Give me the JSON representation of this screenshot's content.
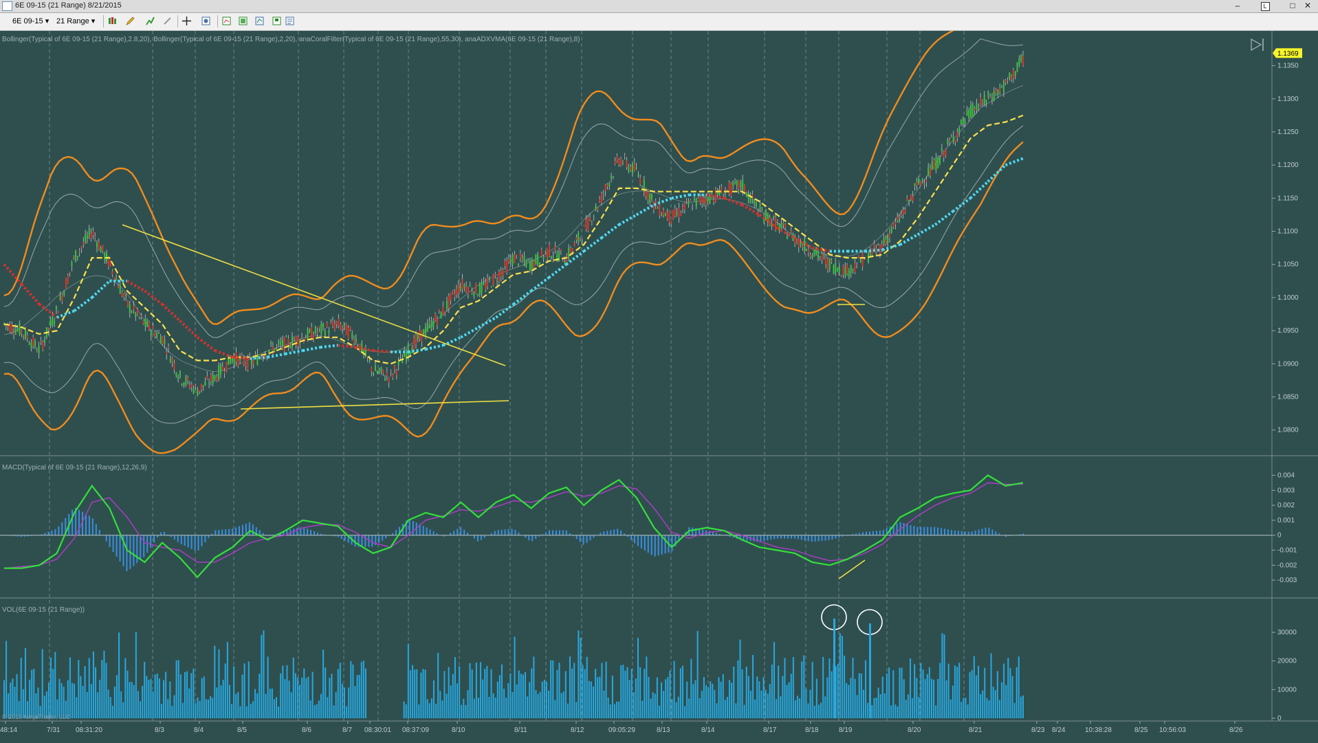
{
  "window": {
    "title": "6E 09-15 (21 Range)  8/21/2015",
    "minimize": "‒",
    "restore": "□",
    "close": "✕",
    "overlay_label": "L"
  },
  "toolbar": {
    "instrument": "6E 09-15",
    "period": "21 Range",
    "icons": [
      "bar-type-icon",
      "draw-pencil-icon",
      "marker-icon",
      "zoom-icon",
      "crosshair-icon",
      "properties-icon",
      "strategy-icon",
      "data-box-icon",
      "chart-trader-icon",
      "save-icon",
      "template-icon"
    ]
  },
  "colors": {
    "background": "#2f4f4f",
    "bollinger_outer": "#f28c1c",
    "bollinger_inner": "#9aa8a8",
    "coral_up": "#ffe14a",
    "coral_down": "#ffe14a",
    "adxvma_up": "#4fd9f0",
    "adxvma_down": "#d9302a",
    "trendline": "#f0e040",
    "macd": "#34e03a",
    "macd_avg": "#b03cc8",
    "macd_hist": "#3a8ee0",
    "volume": "#27a8e0",
    "last_price_marker": "#f7f52a"
  },
  "chart_data": [
    {
      "type": "line",
      "panel": "price",
      "title": "Bollinger(Typical of 6E 09-15 (21 Range),2.8,20), Bollinger(Typical of 6E 09-15 (21 Range),2,20), anaCoralFilter(Typical of 6E 09-15 (21 Range),55,30), anaADXVMA(6E 09-15 (21 Range),8)",
      "ylim": [
        1.078,
        1.139
      ],
      "y_ticks": [
        "1.1350",
        "1.1300",
        "1.1250",
        "1.1200",
        "1.1150",
        "1.1100",
        "1.1050",
        "1.1000",
        "1.0950",
        "1.0900",
        "1.0850",
        "1.0800"
      ],
      "last_price": "1.1369",
      "x_labels": [
        "48:14",
        "7/31",
        "08:31:20",
        "8/3",
        "8/4",
        "8/5",
        "8/6",
        "8/7",
        "08:30:01",
        "08:37:09",
        "8/10",
        "8/11",
        "8/12",
        "09:05:29",
        "8/13",
        "8/14",
        "8/17",
        "8/18",
        "8/19",
        "8/20",
        "8/21",
        "8/23",
        "8/24",
        "10:38:28",
        "8/25",
        "10:56:03",
        "8/26"
      ],
      "copyright": "© 2015 NinjaTrader, LLC",
      "series": [
        {
          "name": "Typical (price)",
          "values": [
            1.096,
            1.095,
            1.092,
            1.098,
            1.106,
            1.11,
            1.105,
            1.099,
            1.096,
            1.094,
            1.088,
            1.086,
            1.088,
            1.091,
            1.09,
            1.092,
            1.093,
            1.094,
            1.095,
            1.096,
            1.094,
            1.089,
            1.088,
            1.092,
            1.095,
            1.098,
            1.102,
            1.101,
            1.103,
            1.106,
            1.105,
            1.107,
            1.106,
            1.11,
            1.115,
            1.121,
            1.119,
            1.114,
            1.112,
            1.114,
            1.115,
            1.116,
            1.117,
            1.113,
            1.111,
            1.109,
            1.107,
            1.105,
            1.104,
            1.106,
            1.108,
            1.112,
            1.117,
            1.12,
            1.124,
            1.128,
            1.13,
            1.132,
            1.136
          ]
        },
        {
          "name": "Coral Filter",
          "values": [
            1.096,
            1.0955,
            1.0945,
            1.095,
            1.1,
            1.106,
            1.106,
            1.101,
            1.0985,
            1.096,
            1.092,
            1.0905,
            1.0905,
            1.091,
            1.091,
            1.0915,
            1.0925,
            1.0935,
            1.094,
            1.094,
            1.0925,
            1.0905,
            1.09,
            1.091,
            1.0925,
            1.095,
            1.0985,
            1.0995,
            1.1015,
            1.1035,
            1.104,
            1.1055,
            1.106,
            1.108,
            1.112,
            1.1165,
            1.1165,
            1.116,
            1.116,
            1.116,
            1.116,
            1.116,
            1.116,
            1.1145,
            1.1125,
            1.1105,
            1.1085,
            1.1065,
            1.106,
            1.106,
            1.1065,
            1.1085,
            1.112,
            1.116,
            1.12,
            1.124,
            1.126,
            1.1265,
            1.1275
          ]
        },
        {
          "name": "ADXVMA",
          "values": [
            1.105,
            1.102,
            1.099,
            1.097,
            1.098,
            1.1,
            1.1025,
            1.1025,
            1.101,
            1.099,
            1.0965,
            1.094,
            1.092,
            1.091,
            1.0908,
            1.091,
            1.0915,
            1.092,
            1.0925,
            1.0928,
            1.0925,
            1.092,
            1.0918,
            1.0918,
            1.0922,
            1.0928,
            1.094,
            1.0955,
            1.097,
            1.099,
            1.101,
            1.103,
            1.105,
            1.107,
            1.109,
            1.111,
            1.1125,
            1.114,
            1.115,
            1.1155,
            1.1155,
            1.115,
            1.114,
            1.1125,
            1.1105,
            1.109,
            1.1075,
            1.107,
            1.107,
            1.107,
            1.1072,
            1.108,
            1.1095,
            1.111,
            1.113,
            1.115,
            1.1175,
            1.12,
            1.121
          ]
        }
      ]
    },
    {
      "type": "line",
      "panel": "macd",
      "title": "MACD(Typical of 6E 09-15 (21 Range),12,26,9)",
      "ylim": [
        -0.0035,
        0.0043
      ],
      "y_ticks": [
        "0.004",
        "0.003",
        "0.002",
        "0.001",
        "0",
        "-0.001",
        "-0.002",
        "-0.003"
      ],
      "series": [
        {
          "name": "MACD",
          "values": [
            -0.0022,
            -0.0022,
            -0.002,
            -0.0012,
            0.0015,
            0.0033,
            0.0018,
            -0.001,
            -0.0018,
            -0.0005,
            -0.0015,
            -0.0028,
            -0.0015,
            -0.0008,
            0.0003,
            -0.0003,
            0.0003,
            0.001,
            0.0008,
            0.0006,
            -0.0005,
            -0.0012,
            -0.0008,
            0.001,
            0.0015,
            0.0012,
            0.0022,
            0.0012,
            0.0022,
            0.0027,
            0.0018,
            0.0028,
            0.0032,
            0.002,
            0.003,
            0.0037,
            0.0025,
            0.0005,
            -0.0008,
            0.0003,
            0.0005,
            0.0003,
            -0.0003,
            -0.0008,
            -0.001,
            -0.0012,
            -0.0018,
            -0.002,
            -0.0016,
            -0.001,
            -0.0003,
            0.0012,
            0.0018,
            0.0025,
            0.0028,
            0.003,
            0.004,
            0.0033,
            0.0035
          ]
        },
        {
          "name": "Avg",
          "values": [
            -0.0022,
            -0.0021,
            -0.002,
            -0.0016,
            -0.0002,
            0.0022,
            0.0025,
            0.0012,
            -0.0005,
            -0.0008,
            -0.001,
            -0.0018,
            -0.0018,
            -0.0012,
            -0.0005,
            -0.0002,
            0.0,
            0.0005,
            0.0007,
            0.0007,
            0.0002,
            -0.0005,
            -0.0008,
            0.0,
            0.001,
            0.0013,
            0.0017,
            0.0016,
            0.0019,
            0.0023,
            0.0022,
            0.0025,
            0.0029,
            0.0026,
            0.0028,
            0.0033,
            0.0031,
            0.0018,
            0.0002,
            -0.0002,
            0.0002,
            0.0003,
            0.0,
            -0.0004,
            -0.0008,
            -0.001,
            -0.0014,
            -0.0017,
            -0.0016,
            -0.0012,
            -0.0006,
            0.0004,
            0.0013,
            0.002,
            0.0025,
            0.0028,
            0.0035,
            0.0034,
            0.0034
          ]
        }
      ]
    },
    {
      "type": "bar",
      "panel": "volume",
      "title": "VOL(6E 09-15 (21 Range))",
      "ylim": [
        0,
        36000
      ],
      "y_ticks": [
        "30000",
        "20000",
        "10000",
        "0"
      ]
    }
  ]
}
